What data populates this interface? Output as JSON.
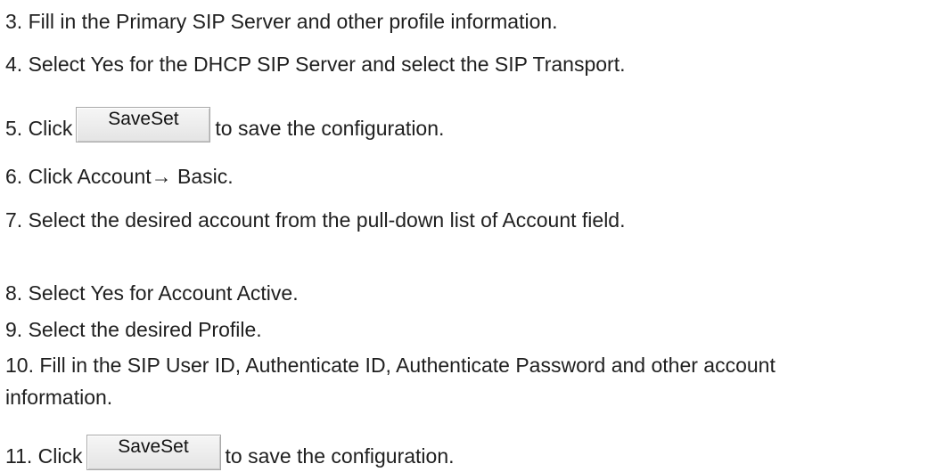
{
  "steps": {
    "s3": "3. Fill in the Primary SIP Server and other profile information.",
    "s4": "4. Select Yes for the DHCP SIP Server and select the SIP Transport.",
    "s5_before": "5. Click",
    "s5_button": "SaveSet",
    "s5_after": "to save the configuration.",
    "s6": "6. Click Account→ Basic.",
    "s7": "7. Select the desired account from the pull-down list of Account field.",
    "s8": "8. Select Yes for Account Active.",
    "s9": "9. Select the desired Profile.",
    "s10_line1": "10. Fill in the SIP User ID, Authenticate ID, Authenticate Password and other account",
    "s10_line2": "information.",
    "s11_before": "11. Click",
    "s11_button": "SaveSet",
    "s11_after": "to save the configuration."
  }
}
